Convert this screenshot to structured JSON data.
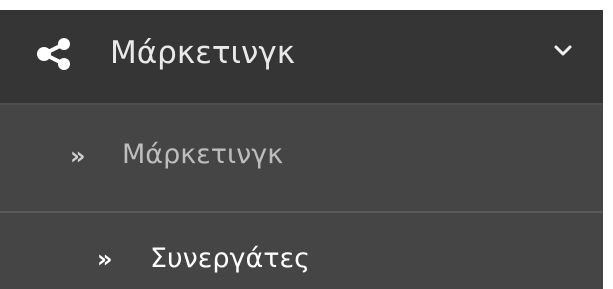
{
  "menu": {
    "header": {
      "icon": "share-icon",
      "label": "Μάρκετινγκ",
      "toggle_icon": "chevron-down-icon",
      "expanded": true
    },
    "items": [
      {
        "icon": "double-chevron-right-icon",
        "arrow": "»",
        "label": "Μάρκετινγκ",
        "active": false
      },
      {
        "icon": "double-chevron-right-icon",
        "arrow": "»",
        "label": "Συνεργάτες",
        "active": true
      }
    ]
  },
  "colors": {
    "header_background": "#353535",
    "submenu_background": "#454545",
    "divider": "#5a5a5a",
    "header_text": "#e9e9e9",
    "inactive_text": "#bdbdbd",
    "active_text": "#ffffff"
  }
}
